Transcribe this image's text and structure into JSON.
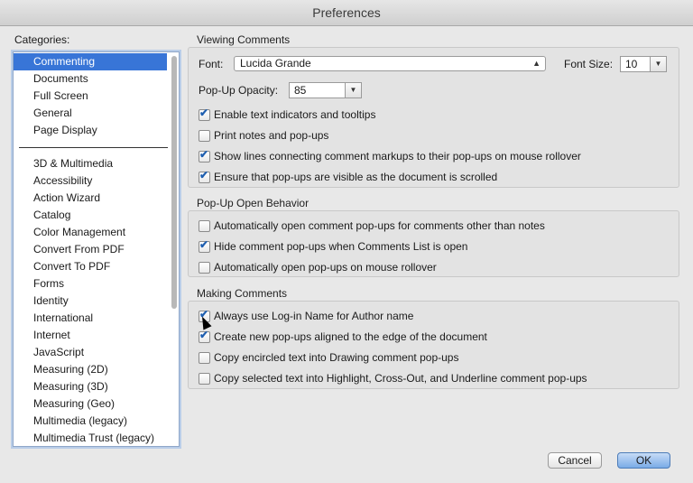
{
  "window": {
    "title": "Preferences"
  },
  "categories": {
    "label": "Categories:",
    "top_items": [
      "Commenting",
      "Documents",
      "Full Screen",
      "General",
      "Page Display"
    ],
    "items": [
      "3D & Multimedia",
      "Accessibility",
      "Action Wizard",
      "Catalog",
      "Color Management",
      "Convert From PDF",
      "Convert To PDF",
      "Forms",
      "Identity",
      "International",
      "Internet",
      "JavaScript",
      "Measuring (2D)",
      "Measuring (3D)",
      "Measuring (Geo)",
      "Multimedia (legacy)",
      "Multimedia Trust (legacy)"
    ],
    "selected": "Commenting"
  },
  "viewing": {
    "title": "Viewing Comments",
    "font_label": "Font:",
    "font_value": "Lucida Grande",
    "font_size_label": "Font Size:",
    "font_size_value": "10",
    "opacity_label": "Pop-Up Opacity:",
    "opacity_value": "85",
    "options": [
      {
        "label": "Enable text indicators and tooltips",
        "checked": true
      },
      {
        "label": "Print notes and pop-ups",
        "checked": false
      },
      {
        "label": "Show lines connecting comment markups to their pop-ups on mouse rollover",
        "checked": true
      },
      {
        "label": "Ensure that pop-ups are visible as the document is scrolled",
        "checked": true
      }
    ]
  },
  "popup": {
    "title": "Pop-Up Open Behavior",
    "options": [
      {
        "label": "Automatically open comment pop-ups for comments other than notes",
        "checked": false
      },
      {
        "label": "Hide comment pop-ups when Comments List is open",
        "checked": true
      },
      {
        "label": "Automatically open pop-ups on mouse rollover",
        "checked": false
      }
    ]
  },
  "making": {
    "title": "Making Comments",
    "options": [
      {
        "label": "Always use Log-in Name for Author name",
        "checked": true
      },
      {
        "label": "Create new pop-ups aligned to the edge of the document",
        "checked": true
      },
      {
        "label": "Copy encircled text into Drawing comment pop-ups",
        "checked": false
      },
      {
        "label": "Copy selected text into Highlight, Cross-Out, and Underline comment pop-ups",
        "checked": false
      }
    ]
  },
  "buttons": {
    "cancel": "Cancel",
    "ok": "OK"
  }
}
